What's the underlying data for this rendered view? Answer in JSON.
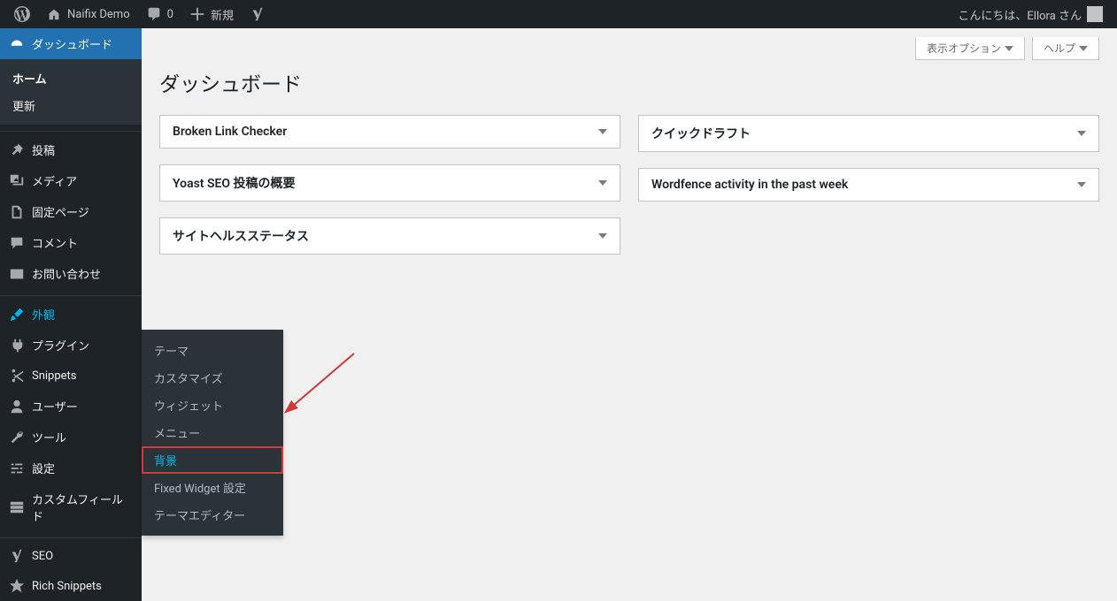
{
  "adminbar": {
    "site_name": "Naifix Demo",
    "comments": "0",
    "new": "新規",
    "greeting": "こんにちは、Ellora さん"
  },
  "sidebar": {
    "dashboard": "ダッシュボード",
    "dashboard_sub": {
      "home": "ホーム",
      "updates": "更新"
    },
    "posts": "投稿",
    "media": "メディア",
    "pages": "固定ページ",
    "comments": "コメント",
    "contact": "お問い合わせ",
    "appearance": "外観",
    "plugins": "プラグイン",
    "snippets": "Snippets",
    "users": "ユーザー",
    "tools": "ツール",
    "settings": "設定",
    "custom_fields": "カスタムフィールド",
    "seo": "SEO",
    "rich_snippets": "Rich Snippets"
  },
  "flyout": {
    "themes": "テーマ",
    "customize": "カスタマイズ",
    "widgets": "ウィジェット",
    "menus": "メニュー",
    "background": "背景",
    "fixed_widget": "Fixed Widget 設定",
    "theme_editor": "テーマエディター"
  },
  "content": {
    "screen_options": "表示オプション",
    "help": "ヘルプ",
    "title": "ダッシュボード"
  },
  "widgets": {
    "blc": "Broken Link Checker",
    "yoast": "Yoast SEO 投稿の概要",
    "site_health": "サイトヘルスステータス",
    "quick_draft": "クイックドラフト",
    "wordfence": "Wordfence activity in the past week"
  }
}
